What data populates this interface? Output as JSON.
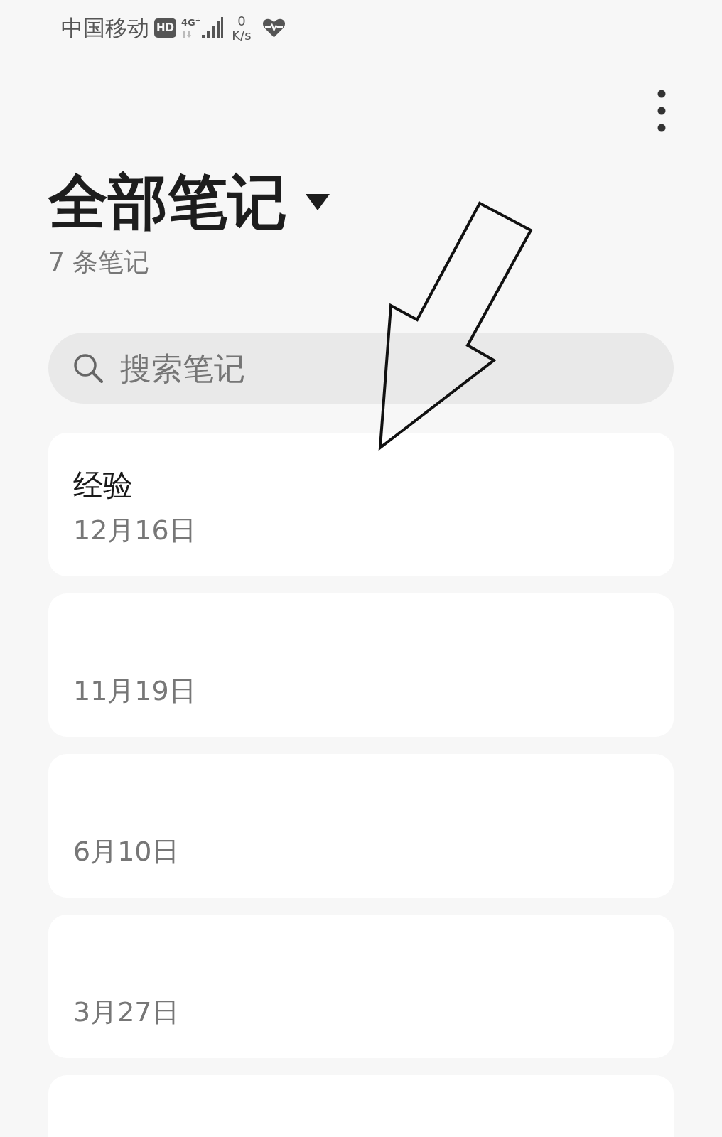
{
  "status_bar": {
    "carrier": "中国移动",
    "hd_badge": "HD",
    "network": "4G$^{+}$",
    "speed_value": "0",
    "speed_unit": "K/s"
  },
  "header": {
    "title": "全部笔记",
    "note_count": "7 条笔记"
  },
  "search": {
    "placeholder": "搜索笔记"
  },
  "notes": [
    {
      "title": "经验",
      "date": "12月16日",
      "cut_off": false
    },
    {
      "date": "11月19日",
      "cut_off": false
    },
    {
      "date": "6月10日",
      "cut_off": false
    },
    {
      "date": "3月27日",
      "cut_off": false
    },
    {
      "cut_off": true
    }
  ]
}
